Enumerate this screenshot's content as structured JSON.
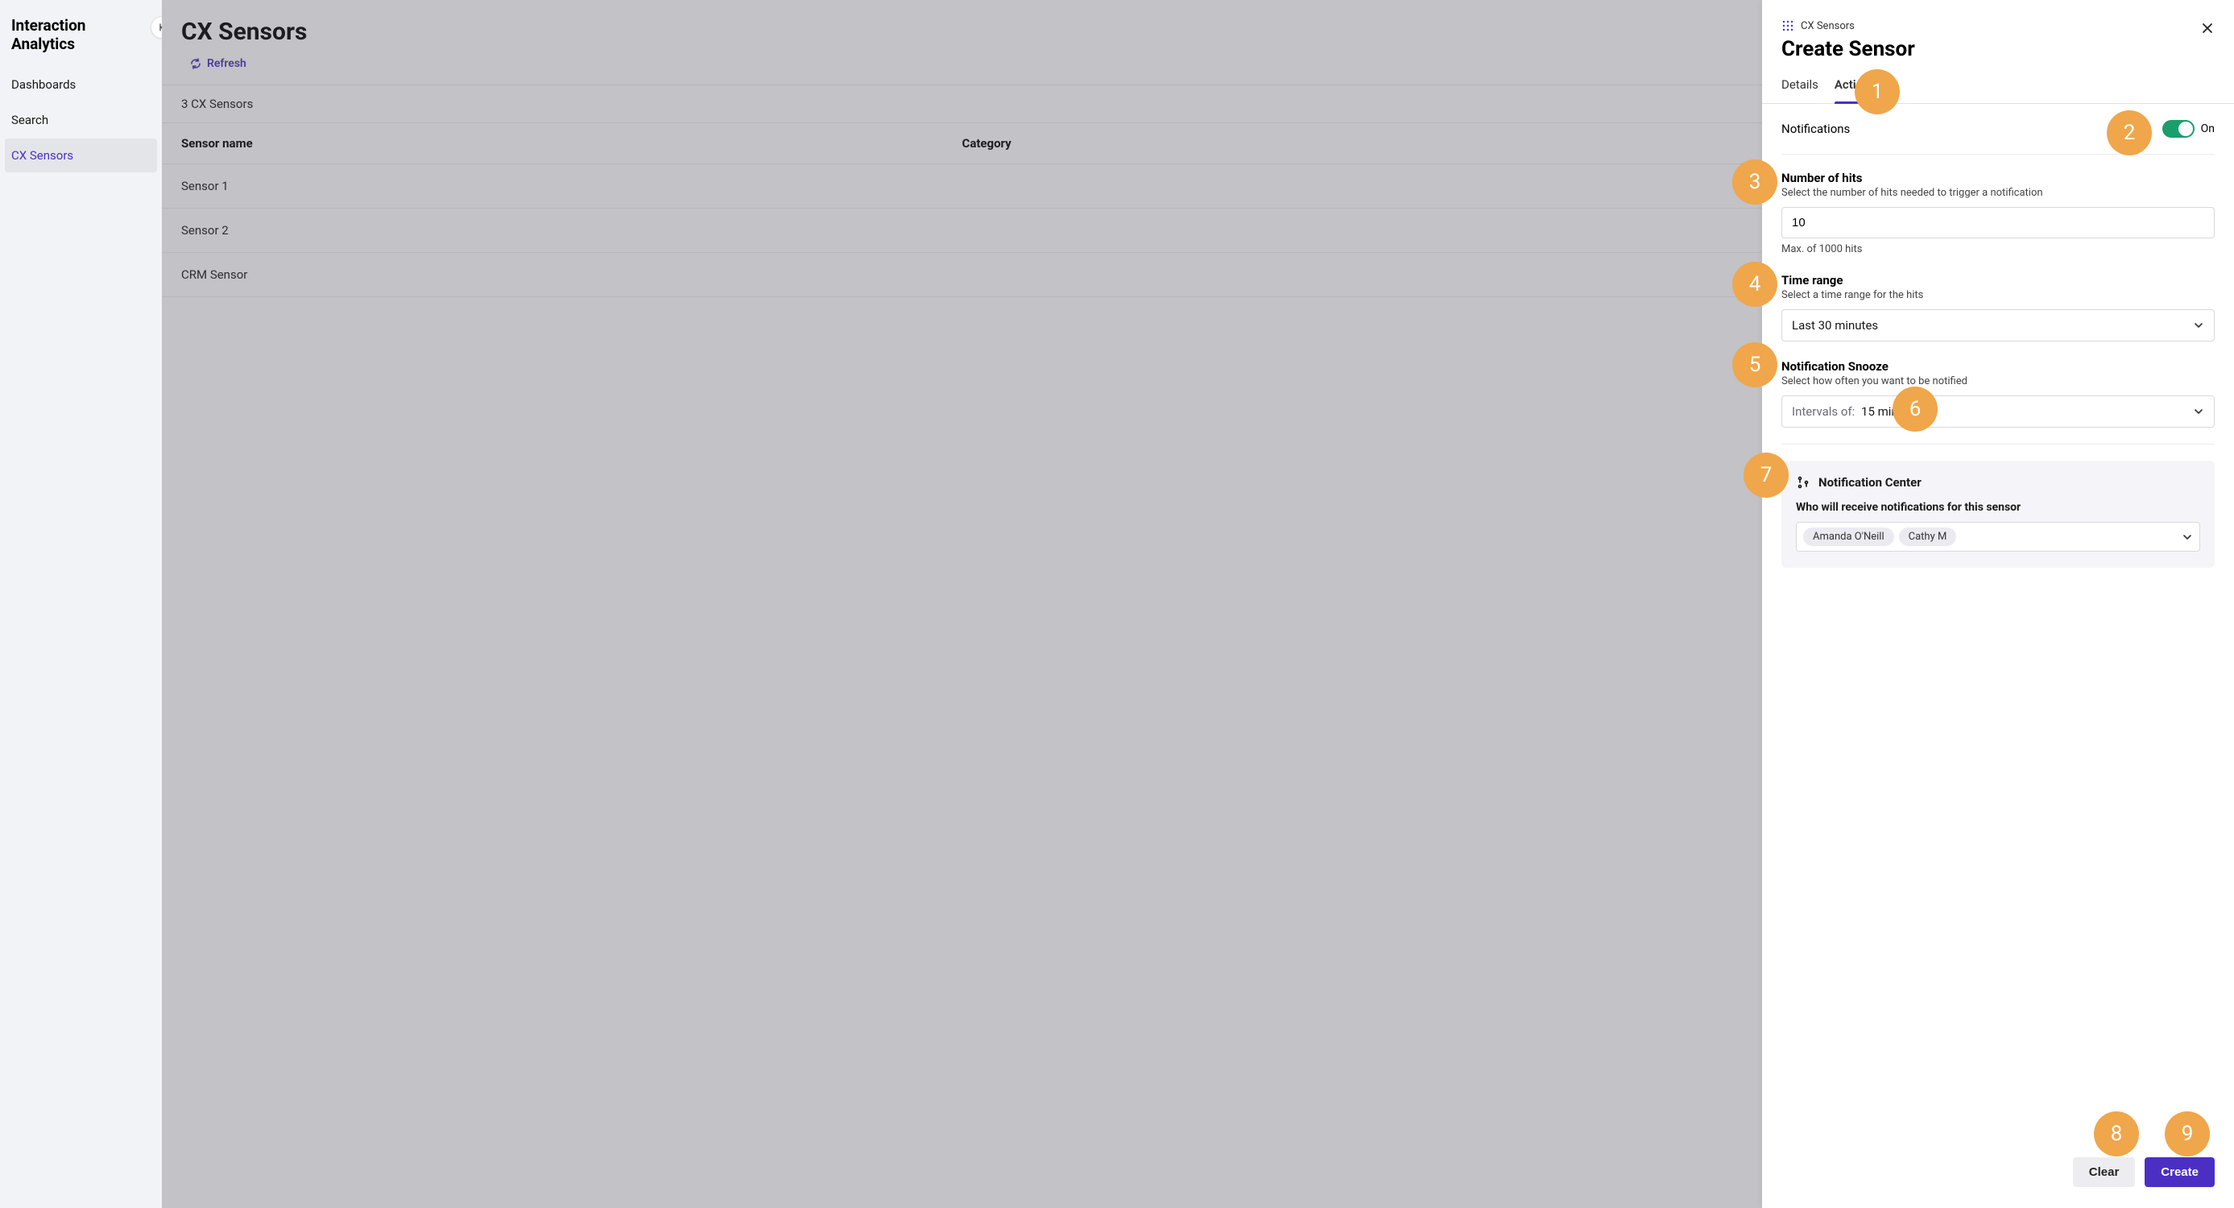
{
  "sidebar": {
    "title": "Interaction Analytics",
    "items": [
      {
        "label": "Dashboards"
      },
      {
        "label": "Search"
      },
      {
        "label": "CX Sensors"
      }
    ],
    "active_index": 2
  },
  "main": {
    "title": "CX Sensors",
    "refresh_label": "Refresh",
    "count_label": "3 CX Sensors",
    "columns": {
      "name": "Sensor name",
      "category": "Category"
    },
    "rows": [
      {
        "name": "Sensor 1",
        "category": ""
      },
      {
        "name": "Sensor 2",
        "category": ""
      },
      {
        "name": "CRM Sensor",
        "category": ""
      }
    ]
  },
  "panel": {
    "crumb": "CX Sensors",
    "title": "Create Sensor",
    "tabs": {
      "details": "Details",
      "actions": "Actions"
    },
    "notifications": {
      "label": "Notifications",
      "toggle_label": "On",
      "on": true
    },
    "number_of_hits": {
      "label": "Number of hits",
      "description": "Select the number of hits needed to trigger a notification",
      "value": "10",
      "hint": "Max. of 1000 hits"
    },
    "time_range": {
      "label": "Time range",
      "description": "Select a time range for the hits",
      "value": "Last 30 minutes"
    },
    "snooze": {
      "label": "Notification Snooze",
      "description": "Select how often you want to be notified",
      "prefix": "Intervals of:",
      "value": "15 min"
    },
    "notification_center": {
      "title": "Notification Center",
      "subtitle": "Who will receive notifications for this sensor",
      "recipients": [
        "Amanda O'Neill",
        "Cathy M"
      ]
    },
    "footer": {
      "clear": "Clear",
      "create": "Create"
    }
  },
  "callouts": [
    "1",
    "2",
    "3",
    "4",
    "5",
    "6",
    "7",
    "8",
    "9"
  ]
}
